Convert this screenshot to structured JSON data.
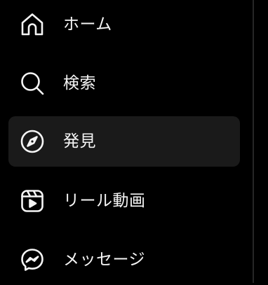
{
  "sidebar": {
    "items": [
      {
        "id": "home",
        "label": "ホーム",
        "icon": "home-icon",
        "active": false
      },
      {
        "id": "search",
        "label": "検索",
        "icon": "search-icon",
        "active": false
      },
      {
        "id": "explore",
        "label": "発見",
        "icon": "compass-icon",
        "active": true
      },
      {
        "id": "reels",
        "label": "リール動画",
        "icon": "reels-icon",
        "active": false
      },
      {
        "id": "messages",
        "label": "メッセージ",
        "icon": "messenger-icon",
        "active": false
      }
    ]
  },
  "colors": {
    "background": "#000000",
    "text": "#f5f5f5",
    "active_background": "#1a1a1a",
    "divider": "#262626"
  }
}
